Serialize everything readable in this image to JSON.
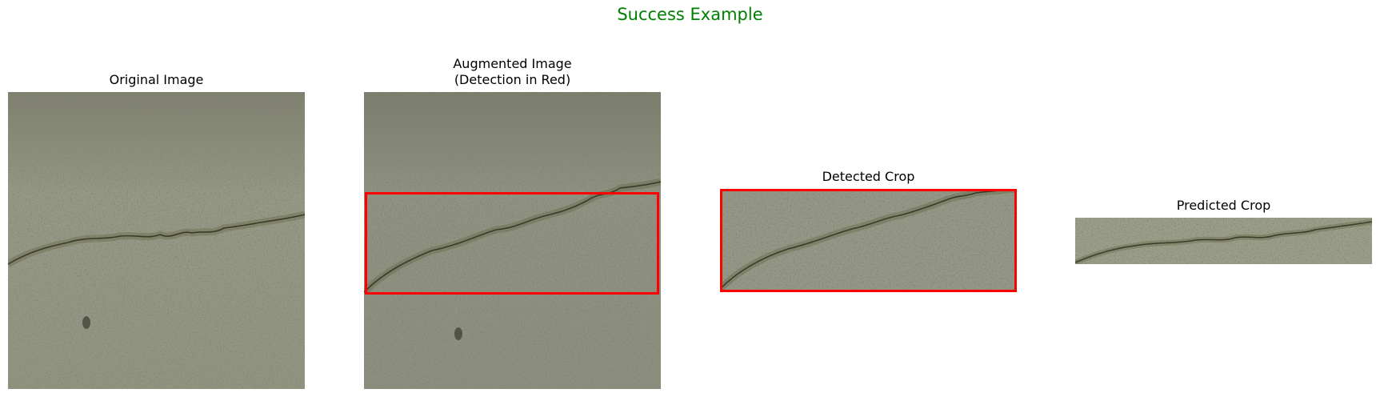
{
  "figure": {
    "suptitle": "Success Example",
    "title_color": "#008000",
    "box_color": "#ff0000"
  },
  "panels": [
    {
      "title": "Original Image"
    },
    {
      "title": "Augmented Image\n(Detection in Red)"
    },
    {
      "title": "Detected Crop"
    },
    {
      "title": "Predicted Crop"
    }
  ]
}
